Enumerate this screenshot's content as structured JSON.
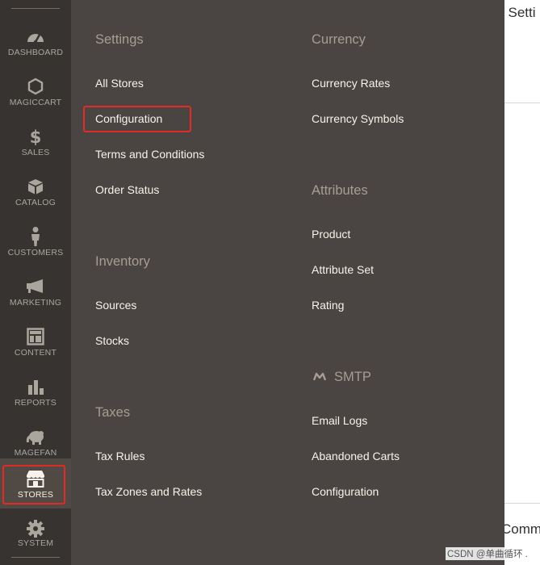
{
  "sidebar": {
    "items": [
      {
        "label": "DASHBOARD",
        "icon": "dashboard-gauge-icon"
      },
      {
        "label": "MAGICCART",
        "icon": "hexagon-icon"
      },
      {
        "label": "SALES",
        "icon": "dollar-icon"
      },
      {
        "label": "CATALOG",
        "icon": "box-icon"
      },
      {
        "label": "CUSTOMERS",
        "icon": "person-icon"
      },
      {
        "label": "MARKETING",
        "icon": "megaphone-icon"
      },
      {
        "label": "CONTENT",
        "icon": "layout-icon"
      },
      {
        "label": "REPORTS",
        "icon": "bar-chart-icon"
      },
      {
        "label": "MAGEFAN",
        "icon": "elephant-icon"
      },
      {
        "label": "STORES",
        "icon": "storefront-icon",
        "active": true
      },
      {
        "label": "SYSTEM",
        "icon": "gear-icon"
      }
    ]
  },
  "flyout": {
    "settings": {
      "title": "Settings",
      "links": [
        "All Stores",
        "Configuration",
        "Terms and Conditions",
        "Order Status"
      ]
    },
    "inventory": {
      "title": "Inventory",
      "links": [
        "Sources",
        "Stocks"
      ]
    },
    "taxes": {
      "title": "Taxes",
      "links": [
        "Tax Rules",
        "Tax Zones and Rates"
      ]
    },
    "currency": {
      "title": "Currency",
      "links": [
        "Currency Rates",
        "Currency Symbols"
      ]
    },
    "attributes": {
      "title": "Attributes",
      "links": [
        "Product",
        "Attribute Set",
        "Rating"
      ]
    },
    "smtp": {
      "title": "SMTP",
      "icon": "smtp-logo-icon",
      "links": [
        "Email Logs",
        "Abandoned Carts",
        "Configuration"
      ]
    }
  },
  "page": {
    "top_fragment": "l Setti",
    "bottom_fragment": "Comm"
  },
  "watermark": "CSDN @单曲循环 .",
  "colors": {
    "sidebar_bg": "#373330",
    "flyout_bg": "#4a4542",
    "section_title": "#a79d95",
    "link_text": "#f7f3eb",
    "highlight": "#e02b27"
  }
}
